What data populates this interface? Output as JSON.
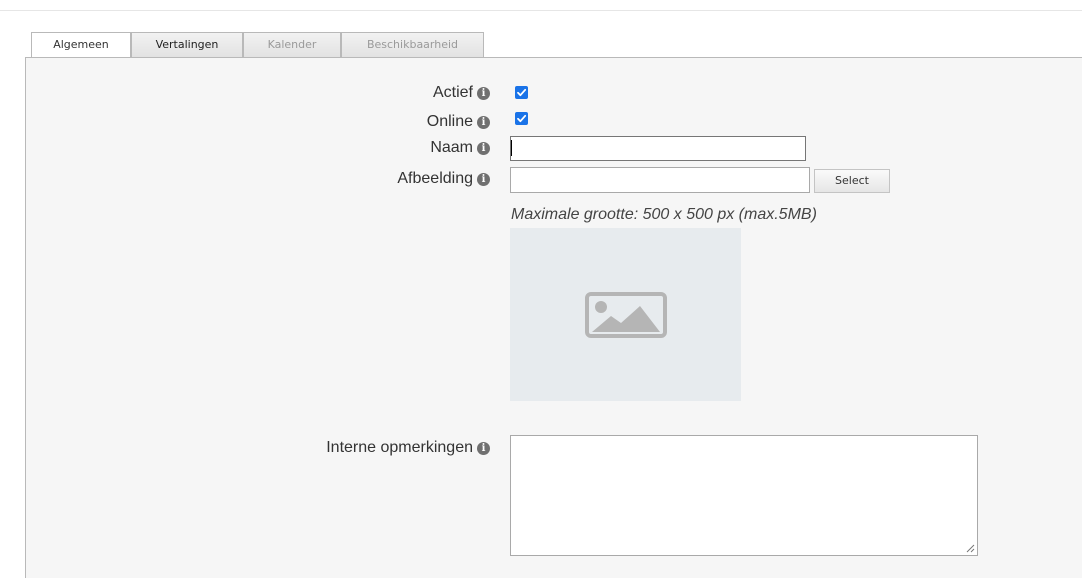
{
  "tabs": [
    {
      "label": "Algemeen",
      "state": "active"
    },
    {
      "label": "Vertalingen",
      "state": "enabled"
    },
    {
      "label": "Kalender",
      "state": "disabled"
    },
    {
      "label": "Beschikbaarheid",
      "state": "disabled"
    }
  ],
  "form": {
    "actief": {
      "label": "Actief",
      "checked": true
    },
    "online": {
      "label": "Online",
      "checked": true
    },
    "naam": {
      "label": "Naam",
      "value": ""
    },
    "afbeelding": {
      "label": "Afbeelding",
      "value": "",
      "select_label": "Select",
      "hint": "Maximale grootte: 500 x 500 px (max.5MB)",
      "placeholder_icon": "image-icon"
    },
    "interne_opmerkingen": {
      "label": "Interne opmerkingen",
      "value": ""
    }
  },
  "icons": {
    "info": "info-icon",
    "check": "check-icon",
    "image": "image-icon",
    "resize": "resize-handle-icon"
  },
  "colors": {
    "accent": "#1a73e8",
    "panel_bg": "#f6f6f6",
    "image_placeholder_bg": "#e7ebee"
  }
}
